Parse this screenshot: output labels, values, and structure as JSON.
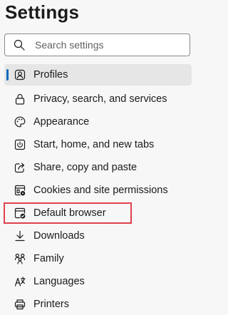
{
  "header": {
    "title": "Settings"
  },
  "search": {
    "placeholder": "Search settings"
  },
  "sidebar": {
    "items": [
      {
        "label": "Profiles",
        "icon": "profile-icon",
        "selected": true
      },
      {
        "label": "Privacy, search, and services",
        "icon": "lock-icon"
      },
      {
        "label": "Appearance",
        "icon": "palette-icon"
      },
      {
        "label": "Start, home, and new tabs",
        "icon": "power-icon"
      },
      {
        "label": "Share, copy and paste",
        "icon": "share-icon"
      },
      {
        "label": "Cookies and site permissions",
        "icon": "site-permissions-icon"
      },
      {
        "label": "Default browser",
        "icon": "browser-icon",
        "highlighted": true
      },
      {
        "label": "Downloads",
        "icon": "download-icon"
      },
      {
        "label": "Family",
        "icon": "family-icon"
      },
      {
        "label": "Languages",
        "icon": "languages-icon"
      },
      {
        "label": "Printers",
        "icon": "printer-icon"
      }
    ]
  },
  "colors": {
    "accent": "#0f6cbd",
    "selected_bg": "#e6e6e6",
    "highlight_border": "#e0414b",
    "background": "#f7f7f7"
  }
}
